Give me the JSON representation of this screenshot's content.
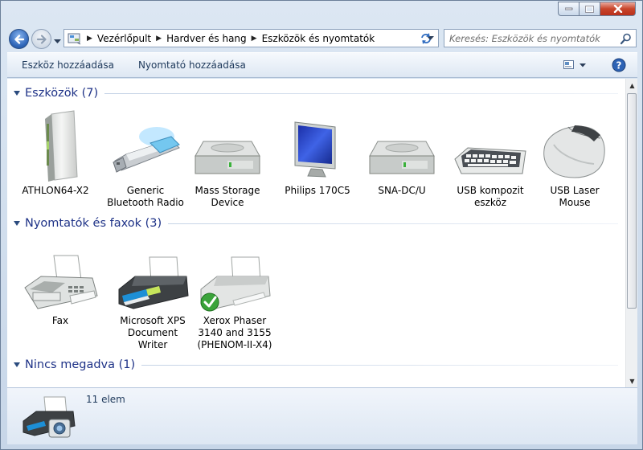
{
  "address": {
    "crumbs": [
      "Vezérlőpult",
      "Hardver és hang",
      "Eszközök és nyomtatók"
    ]
  },
  "search": {
    "placeholder": "Keresés: Eszközök és nyomtatók"
  },
  "commandbar": {
    "add_device": "Eszköz hozzáadása",
    "add_printer": "Nyomtató hozzáadása"
  },
  "groups": {
    "devices": {
      "title": "Eszközök (7)"
    },
    "printers": {
      "title": "Nyomtatók és faxok (3)"
    },
    "unspecified": {
      "title": "Nincs megadva (1)"
    }
  },
  "devices": [
    {
      "label": "ATHLON64-X2",
      "icon": "computer-tower-icon"
    },
    {
      "label": "Generic Bluetooth Radio",
      "icon": "usb-bluetooth-icon"
    },
    {
      "label": "Mass Storage Device",
      "icon": "hard-drive-icon"
    },
    {
      "label": "Philips 170C5",
      "icon": "monitor-icon"
    },
    {
      "label": "SNA-DC/U",
      "icon": "hard-drive-icon"
    },
    {
      "label": "USB kompozit eszköz",
      "icon": "keyboard-icon"
    },
    {
      "label": "USB Laser Mouse",
      "icon": "mouse-icon"
    }
  ],
  "printers": [
    {
      "label": "Fax",
      "icon": "fax-icon"
    },
    {
      "label": "Microsoft XPS Document Writer",
      "icon": "printer-icon"
    },
    {
      "label": "Xerox Phaser 3140 and 3155 (PHENOM-II-X4)",
      "icon": "printer-default-icon"
    }
  ],
  "details": {
    "count": "11 elem"
  }
}
